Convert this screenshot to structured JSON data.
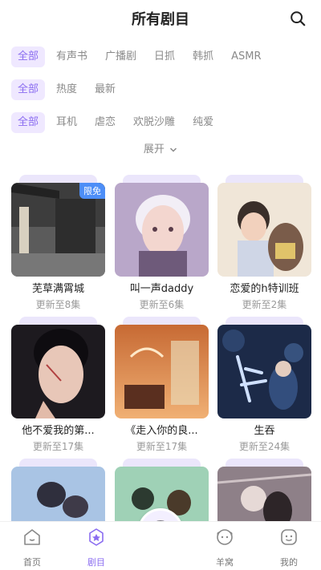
{
  "header": {
    "title": "所有剧目"
  },
  "filters": {
    "category": [
      "全部",
      "有声书",
      "广播剧",
      "日抓",
      "韩抓",
      "ASMR"
    ],
    "sort": [
      "全部",
      "热度",
      "最新"
    ],
    "tags": [
      "全部",
      "耳机",
      "虐恋",
      "欢脱沙雕",
      "纯爱"
    ],
    "expand_label": "展开"
  },
  "cards": [
    {
      "title": "芜草满霄城",
      "episodes": "更新至8集",
      "badge": "限免"
    },
    {
      "title": "叫一声daddy",
      "episodes": "更新至6集"
    },
    {
      "title": "恋爱的h特训班",
      "episodes": "更新至2集"
    },
    {
      "title": "他不爱我的第...",
      "episodes": "更新至17集"
    },
    {
      "title": "《走入你的良...",
      "episodes": "更新至17集"
    },
    {
      "title": "生吞",
      "episodes": "更新至24集"
    }
  ],
  "nav": {
    "home": "首页",
    "drama": "剧目",
    "nest": "羊窝",
    "mine": "我的"
  },
  "colors": {
    "accent": "#8a6cf0",
    "chip_bg": "#efe8ff",
    "badge": "#4d8ef7"
  }
}
